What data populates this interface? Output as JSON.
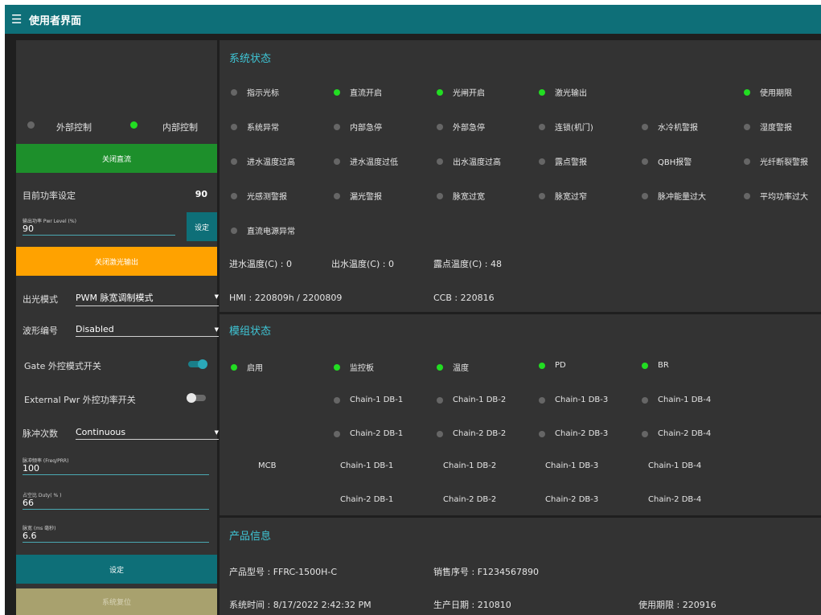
{
  "header": {
    "menu_icon": "hamburger-icon",
    "title": "使用者界面"
  },
  "left": {
    "control": {
      "external_label": "外部控制",
      "internal_label": "内部控制"
    },
    "close_dc_button": "关闭直流",
    "current_power": {
      "label": "目前功率设定",
      "value": "90"
    },
    "power_field": {
      "label": "输出功率 Pwr Level (%)",
      "value": "90"
    },
    "set_button": "设定",
    "close_laser_button": "关闭激光输出",
    "output_mode": {
      "label": "出光模式",
      "value": "PWM 脉宽调制模式"
    },
    "waveform": {
      "label": "波形编号",
      "value": "Disabled"
    },
    "gate_toggle": {
      "label": "Gate 外控模式开关",
      "on": true
    },
    "ext_pwr_toggle": {
      "label": "External Pwr 外控功率开关",
      "on": false
    },
    "pulse_count": {
      "label": "脉冲次数",
      "value": "Continuous"
    },
    "freq_field": {
      "label": "脉冲频率 (Freq/PRR)",
      "value": "100"
    },
    "duty_field": {
      "label": "占空比 Duty( % )",
      "value": "66"
    },
    "width_field": {
      "label": "脉宽 (ms 毫秒)",
      "value": "6.6"
    },
    "set_button2": "设定",
    "reset_button": "系统复位"
  },
  "system": {
    "title": "系统状态",
    "rows": [
      [
        {
          "label": "指示光标",
          "on": false
        },
        {
          "label": "直流开启",
          "on": true
        },
        {
          "label": "光闸开启",
          "on": true
        },
        {
          "label": "激光输出",
          "on": true
        },
        null,
        {
          "label": "使用期限",
          "on": true
        }
      ],
      [
        {
          "label": "系统异常",
          "on": false
        },
        {
          "label": "内部急停",
          "on": false
        },
        {
          "label": "外部急停",
          "on": false
        },
        {
          "label": "连锁(机门)",
          "on": false
        },
        {
          "label": "水冷机警报",
          "on": false
        },
        {
          "label": "湿度警报",
          "on": false
        }
      ],
      [
        {
          "label": "进水温度过高",
          "on": false
        },
        {
          "label": "进水温度过低",
          "on": false
        },
        {
          "label": "出水温度过高",
          "on": false
        },
        {
          "label": "露点警报",
          "on": false
        },
        {
          "label": "QBH报警",
          "on": false
        },
        {
          "label": "光纤断裂警报",
          "on": false
        }
      ],
      [
        {
          "label": "光感测警报",
          "on": false
        },
        {
          "label": "漏光警报",
          "on": false
        },
        {
          "label": "脉宽过宽",
          "on": false
        },
        {
          "label": "脉宽过窄",
          "on": false
        },
        {
          "label": "脉冲能量过大",
          "on": false
        },
        {
          "label": "平均功率过大",
          "on": false
        }
      ],
      [
        {
          "label": "直流电源异常",
          "on": false
        }
      ]
    ],
    "inlet_temp": "进水温度(C) : 0",
    "outlet_temp": "出水温度(C) : 0",
    "dew_temp": "露点温度(C) : 48",
    "hmi": "HMI : 220809h / 2200809",
    "ccb": "CCB : 220816"
  },
  "module": {
    "title": "模组状态",
    "top": [
      {
        "label": "启用",
        "on": true
      },
      {
        "label": "监控板",
        "on": true
      },
      {
        "label": "温度",
        "on": true
      },
      {
        "label": "PD",
        "on": true
      },
      {
        "label": "BR",
        "on": true
      }
    ],
    "chain1": [
      {
        "label": "Chain-1 DB-1",
        "on": false
      },
      {
        "label": "Chain-1 DB-2",
        "on": false
      },
      {
        "label": "Chain-1 DB-3",
        "on": false
      },
      {
        "label": "Chain-1 DB-4",
        "on": false
      }
    ],
    "chain2": [
      {
        "label": "Chain-2 DB-1",
        "on": false
      },
      {
        "label": "Chain-2 DB-2",
        "on": false
      },
      {
        "label": "Chain-2 DB-3",
        "on": false
      },
      {
        "label": "Chain-2 DB-4",
        "on": false
      }
    ],
    "mcb_label": "MCB",
    "mcb_row1": [
      "Chain-1 DB-1",
      "Chain-1 DB-2",
      "Chain-1 DB-3",
      "Chain-1 DB-4"
    ],
    "mcb_row2": [
      "Chain-2 DB-1",
      "Chain-2 DB-2",
      "Chain-2 DB-3",
      "Chain-2 DB-4"
    ]
  },
  "product": {
    "title": "产品信息",
    "model": "产品型号 : FFRC-1500H-C",
    "serial": "销售序号 : F1234567890",
    "sys_time": "系统时间 : 8/17/2022 2:42:32 PM",
    "prod_date": "生产日期 : 210810",
    "expiry": "使用期限 : 220916"
  },
  "colors": {
    "accent": "#0e6f78",
    "title": "#3fc6d6",
    "led_on": "#22dd22",
    "led_off": "#666666",
    "orange": "#ffa200",
    "green": "#1d8f2b"
  }
}
